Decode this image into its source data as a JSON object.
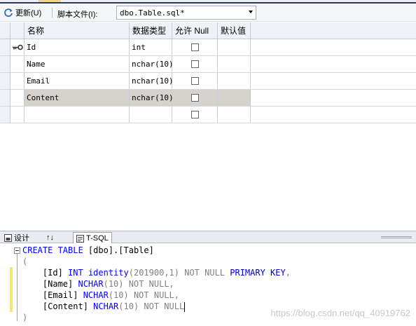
{
  "toolbar": {
    "refresh_label": "更新(U)",
    "script_file_label": "脚本文件(I):",
    "script_file_value": "dbo.Table.sql*"
  },
  "grid": {
    "columns": [
      "名称",
      "数据类型",
      "允许 Null",
      "默认值"
    ],
    "rows": [
      {
        "name": "Id",
        "type": "int",
        "allow_null": false,
        "primary_key": true
      },
      {
        "name": "Name",
        "type": "nchar(10)",
        "allow_null": false,
        "primary_key": false
      },
      {
        "name": "Email",
        "type": "nchar(10)",
        "allow_null": false,
        "primary_key": false
      },
      {
        "name": "Content",
        "type": "nchar(10)",
        "allow_null": false,
        "primary_key": false,
        "selected": true
      },
      {
        "name": "",
        "type": "",
        "allow_null": false,
        "primary_key": false
      }
    ]
  },
  "pane_tabs": [
    {
      "label": "设计",
      "icon": "design-icon"
    },
    {
      "label": "↑↓",
      "icon": "swap-icon"
    },
    {
      "label": "T-SQL",
      "icon": "tsql-icon",
      "active": true
    }
  ],
  "sql": {
    "line1_kw": "CREATE TABLE",
    "line1_rest": " [dbo].[Table]",
    "line2": "(",
    "line3": {
      "col": "    [Id] ",
      "type": "INT",
      "fn": " identity",
      "args": "(201900,1)",
      "nn": " NOT NULL",
      "pk": " PRIMARY KEY",
      "end": ","
    },
    "line4": {
      "col": "    [Name] ",
      "type": "NCHAR",
      "args": "(10)",
      "nn": " NOT NULL",
      "end": ","
    },
    "line5": {
      "col": "    [Email] ",
      "type": "NCHAR",
      "args": "(10)",
      "nn": " NOT NULL",
      "end": ","
    },
    "line6": {
      "col": "    [Content] ",
      "type": "NCHAR",
      "args": "(10)",
      "nn": " NOT NULL"
    },
    "line7": ")"
  },
  "watermark": "https://blog.csdn.net/qq_40919762",
  "colors": {
    "selected_row": "#d6d3ce",
    "keyword": "#0000ff",
    "change_bar": "#f5e67a"
  }
}
